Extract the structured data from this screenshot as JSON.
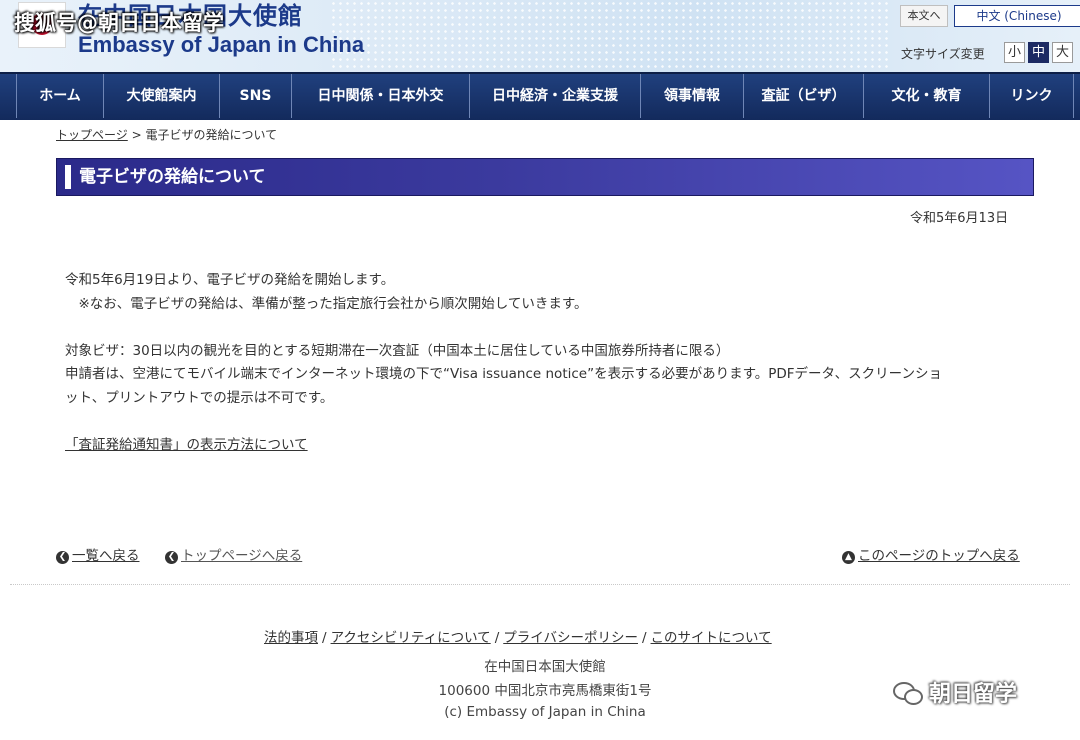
{
  "watermark_top": "搜狐号@朝日日本留学",
  "header": {
    "title_ja": "在中国日本国大使館",
    "title_en": "Embassy of Japan in China",
    "lang_honbun": "本文へ",
    "lang_chinese": "中文 (Chinese)",
    "fontsize_label": "文字サイズ変更",
    "fontsize_small": "小",
    "fontsize_mid": "中",
    "fontsize_large": "大"
  },
  "nav": {
    "items": [
      {
        "label": "ホーム"
      },
      {
        "label": "大使館案内"
      },
      {
        "label": "SNS"
      },
      {
        "label": "日中関係・日本外交"
      },
      {
        "label": "日中経済・企業支援"
      },
      {
        "label": "領事情報"
      },
      {
        "label": "査証（ビザ）"
      },
      {
        "label": "文化・教育"
      },
      {
        "label": "リンク"
      }
    ]
  },
  "breadcrumb": {
    "home": "トップページ",
    "separator": ">",
    "current": "電子ビザの発給について"
  },
  "page": {
    "title": "電子ビザの発給について",
    "date": "令和5年6月13日",
    "para1": "令和5年6月19日より、電子ビザの発給を開始します。",
    "para2": "　※なお、電子ビザの発給は、準備が整った指定旅行会社から順次開始していきます。",
    "para3": "対象ビザ：30日以内の観光を目的とする短期滞在一次査証（中国本土に居住している中国旅券所持者に限る）",
    "para4": "申請者は、空港にてモバイル端末でインターネット環境の下で“Visa issuance notice”を表示する必要があります。PDFデータ、スクリーンショ",
    "para5": "ット、プリントアウトでの提示は不可です。",
    "link_notice": "「査証発給通知書」の表示方法について"
  },
  "back_links": {
    "list": "一覧へ戻る",
    "top": "トップページへ戻る",
    "page_top": "このページのトップへ戻る"
  },
  "footer": {
    "links": [
      "法的事項",
      "アクセシビリティについて",
      "プライバシーポリシー",
      "このサイトについて"
    ],
    "separator": "/",
    "name": "在中国日本国大使館",
    "address": "100600 中国北京市亮馬橋東街1号",
    "copyright": "(c) Embassy of Japan in China"
  },
  "watermark_bottom": "朝日留学",
  "colors": {
    "nav_bg": "#18336c",
    "title_bar": "#3b3a9e",
    "brand_blue": "#1c3a8a",
    "seal_red": "#c8102e"
  }
}
